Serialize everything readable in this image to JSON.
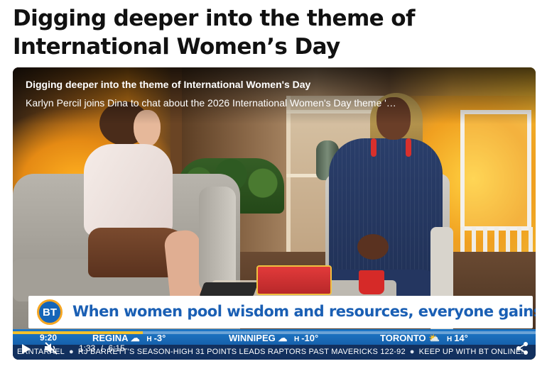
{
  "article": {
    "headline": "Digging deeper into the theme of International Women’s Day"
  },
  "player": {
    "title": "Digging deeper into the theme of International Women's Day",
    "description": "Karlyn Percil joins Dina to chat about the 2026 International Women's Day theme '…",
    "lower_third": {
      "logo": "BT",
      "text": "When women pool wisdom and resources, everyone gains"
    },
    "clock": "9:20",
    "weather": [
      {
        "city": "REGINA",
        "hi_label": "H",
        "temp": "-3°",
        "icon": "cloud-icon"
      },
      {
        "city": "WINNIPEG",
        "hi_label": "H",
        "temp": "-10°",
        "icon": "cloud-icon"
      },
      {
        "city": "TORONTO",
        "hi_label": "H",
        "temp": "14°",
        "icon": "sun-cloud-icon"
      }
    ],
    "ticker": {
      "items": [
        "ERNTARAEL",
        "RJ BARRETT'S SEASON-HIGH 31 POINTS LEADS RAPTORS PAST MAVERICKS 122-92",
        "KEEP UP WITH BT ONLINE!"
      ]
    },
    "controls": {
      "current_time": "1:33",
      "separator": "/",
      "duration": "6:15",
      "progress_fraction": 0.248,
      "muted": true
    },
    "colors": {
      "accent_yellow": "#f3c12c",
      "bt_blue": "#1565b8",
      "lower_third_text": "#1a5fb4",
      "weather_bar": "#1661ac",
      "ticker_bar": "#12305e"
    }
  }
}
